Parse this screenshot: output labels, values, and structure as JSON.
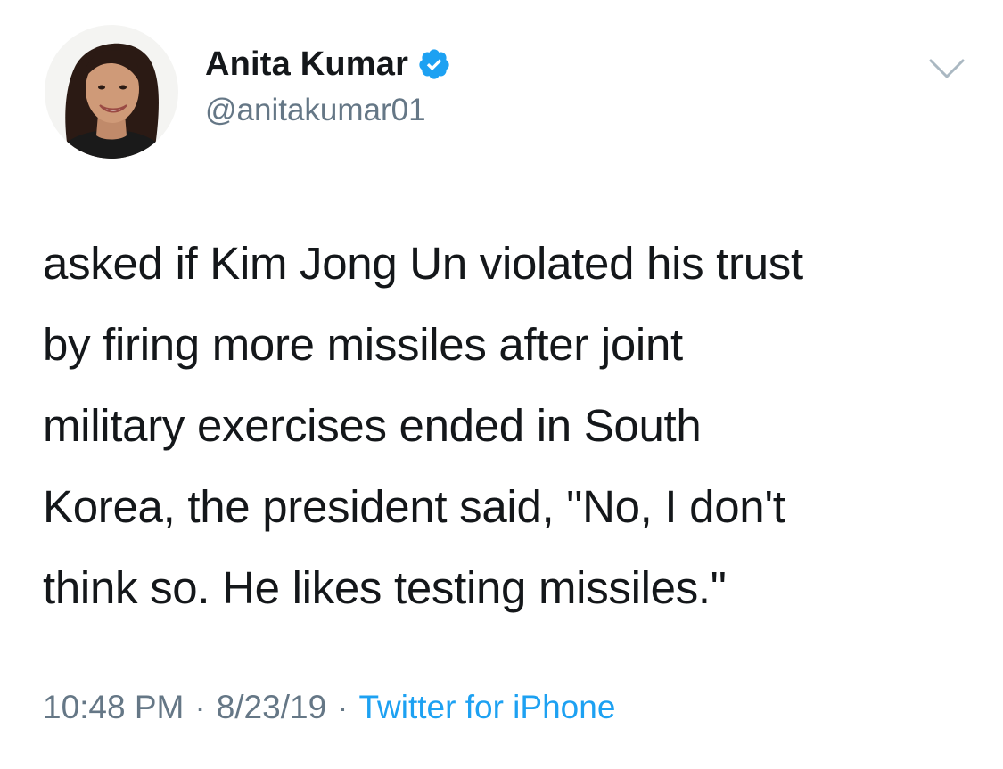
{
  "author": {
    "display_name": "Anita Kumar",
    "handle": "@anitakumar01",
    "verified": true,
    "verified_color": "#1da1f2"
  },
  "tweet": {
    "text": "asked if Kim Jong Un violated his trust\nby firing more missiles after joint\nmilitary exercises ended in South\nKorea, the president said, \"No, I don't\nthink so. He likes testing missiles.\"",
    "time": "10:48 PM",
    "date": "8/23/19",
    "source": "Twitter for iPhone",
    "separator": "·"
  },
  "icons": {
    "menu": "chevron-down-icon",
    "verified": "verified-badge-icon"
  },
  "colors": {
    "text": "#14171a",
    "secondary": "#657786",
    "link": "#1da1f2"
  }
}
